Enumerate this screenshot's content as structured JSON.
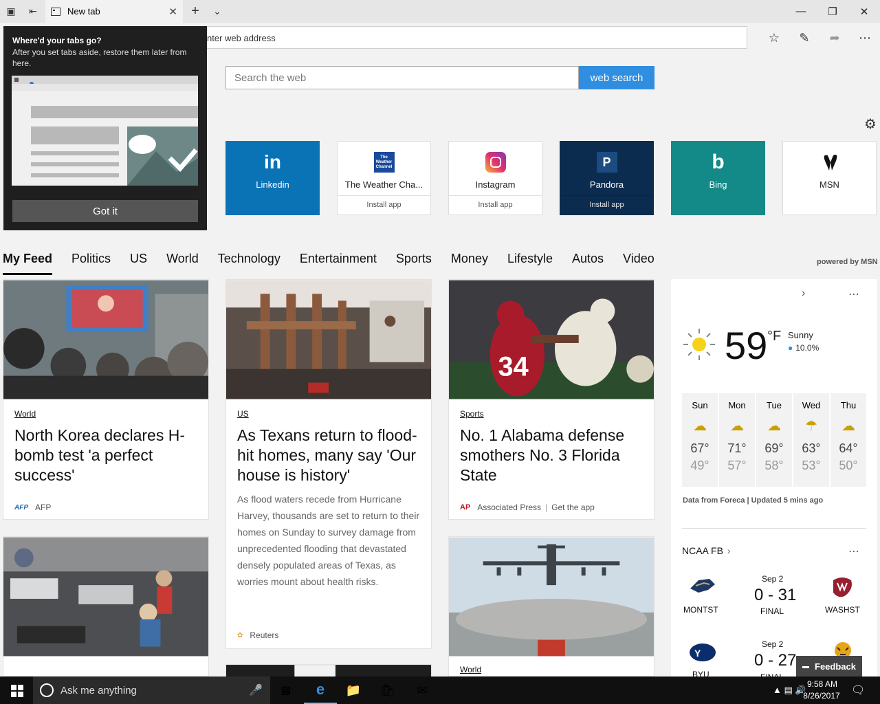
{
  "browser": {
    "tab_title": "New tab",
    "address_placeholder": "nter web address"
  },
  "tooltip": {
    "title": "Where'd your tabs go?",
    "body": "After you set tabs aside, restore them later from here.",
    "button": "Got it"
  },
  "search": {
    "placeholder": "Search the web",
    "button": "web search"
  },
  "tiles": [
    {
      "name": "Linkedin",
      "sub": "",
      "bg": "#0a73b6",
      "fg": "#ffffff",
      "logo": "in"
    },
    {
      "name": "The Weather Cha...",
      "sub": "Install app",
      "bg": "#ffffff",
      "fg": "#222222",
      "logo": "The Weather Channel"
    },
    {
      "name": "Instagram",
      "sub": "Install app",
      "bg": "#ffffff",
      "fg": "#222222",
      "logo": ""
    },
    {
      "name": "Pandora",
      "sub": "Install app",
      "bg": "#0b2c4f",
      "fg": "#ffffff",
      "logo": "P"
    },
    {
      "name": "Bing",
      "sub": "",
      "bg": "#138a87",
      "fg": "#ffffff",
      "logo": "b"
    },
    {
      "name": "MSN",
      "sub": "",
      "bg": "#ffffff",
      "fg": "#222222",
      "logo": ""
    }
  ],
  "feed_nav": [
    "My Feed",
    "Politics",
    "US",
    "World",
    "Technology",
    "Entertainment",
    "Sports",
    "Money",
    "Lifestyle",
    "Autos",
    "Video"
  ],
  "powered_by": "powered by MSN",
  "cards": [
    {
      "category": "World",
      "headline": "North Korea declares H-bomb test 'a perfect success'",
      "summary": "",
      "source": "AFP",
      "source_logo": "AFP"
    },
    {
      "category": "US",
      "headline": "As Texans return to flood-hit homes, many say 'Our house is history'",
      "summary": "As flood waters recede from Hurricane Harvey, thousands are set to return to their homes on Sunday to survey damage from unprecedented flooding that devastated densely populated areas of Texas, as worries mount about health risks.",
      "source": "Reuters",
      "source_logo": ""
    },
    {
      "category": "Sports",
      "headline": "No. 1 Alabama defense smothers No. 3 Florida State",
      "summary": "",
      "source": "Associated Press",
      "source_logo": "AP",
      "extra": "Get the app"
    },
    {
      "category": "World"
    }
  ],
  "weather": {
    "temp": "59",
    "unit": "°F",
    "condition": "Sunny",
    "precip": "10.0%",
    "days": [
      {
        "day": "Sun",
        "hi": "67°",
        "lo": "49°"
      },
      {
        "day": "Mon",
        "hi": "71°",
        "lo": "57°"
      },
      {
        "day": "Tue",
        "hi": "69°",
        "lo": "58°"
      },
      {
        "day": "Wed",
        "hi": "63°",
        "lo": "53°"
      },
      {
        "day": "Thu",
        "hi": "64°",
        "lo": "50°"
      }
    ],
    "footer": "Data from Foreca | Updated 5 mins ago"
  },
  "sports": {
    "title": "NCAA FB",
    "games": [
      {
        "date": "Sep 2",
        "score": "0 - 31",
        "status": "FINAL",
        "home": "MONTST",
        "away": "WASHST"
      },
      {
        "date": "Sep 2",
        "score": "0 - 27",
        "status": "FINAL",
        "home": "BYU",
        "away": ""
      }
    ]
  },
  "feedback": "Feedback",
  "taskbar": {
    "search": "Ask me anything",
    "time": "9:58 AM",
    "date": "8/26/2017"
  }
}
